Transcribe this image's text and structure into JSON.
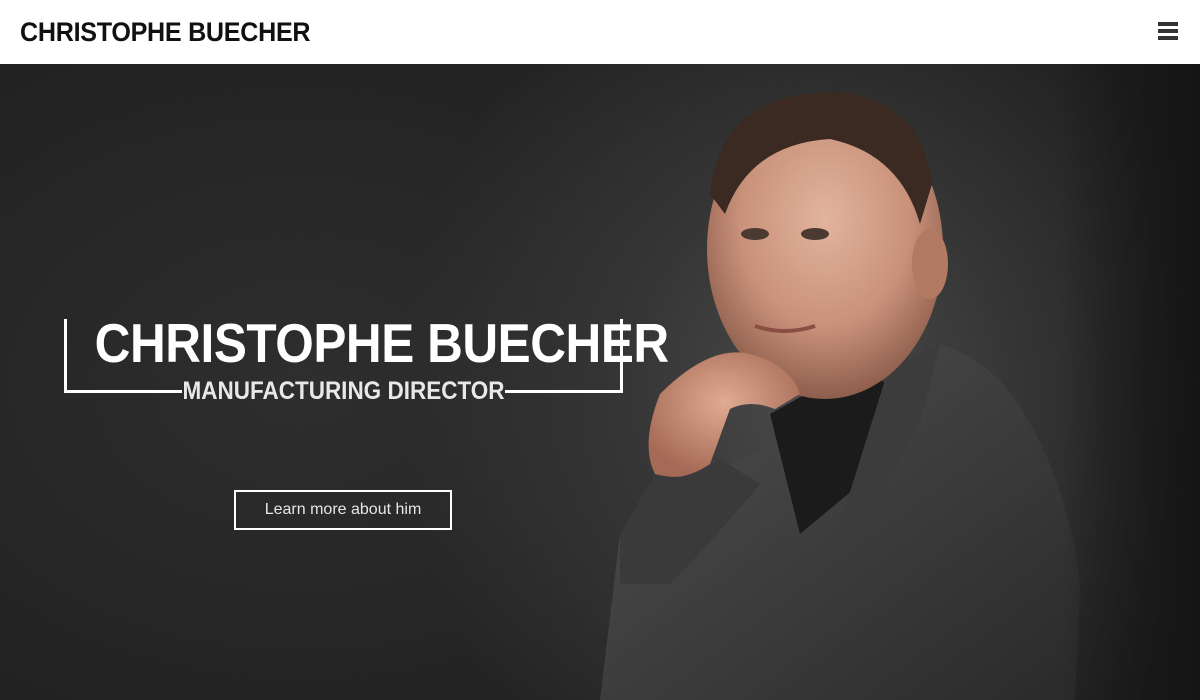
{
  "header": {
    "brand": "CHRISTOPHE BUECHER",
    "menu_icon": "hamburger-menu-icon"
  },
  "hero": {
    "name": "CHRISTOPHE BUECHER",
    "role": "MANUFACTURING DIRECTOR",
    "cta_label": "Learn more about him",
    "image": "portrait-photo"
  },
  "colors": {
    "header_bg": "#ffffff",
    "hero_bg": "#1f1f1f",
    "accent": "#ffffff"
  }
}
